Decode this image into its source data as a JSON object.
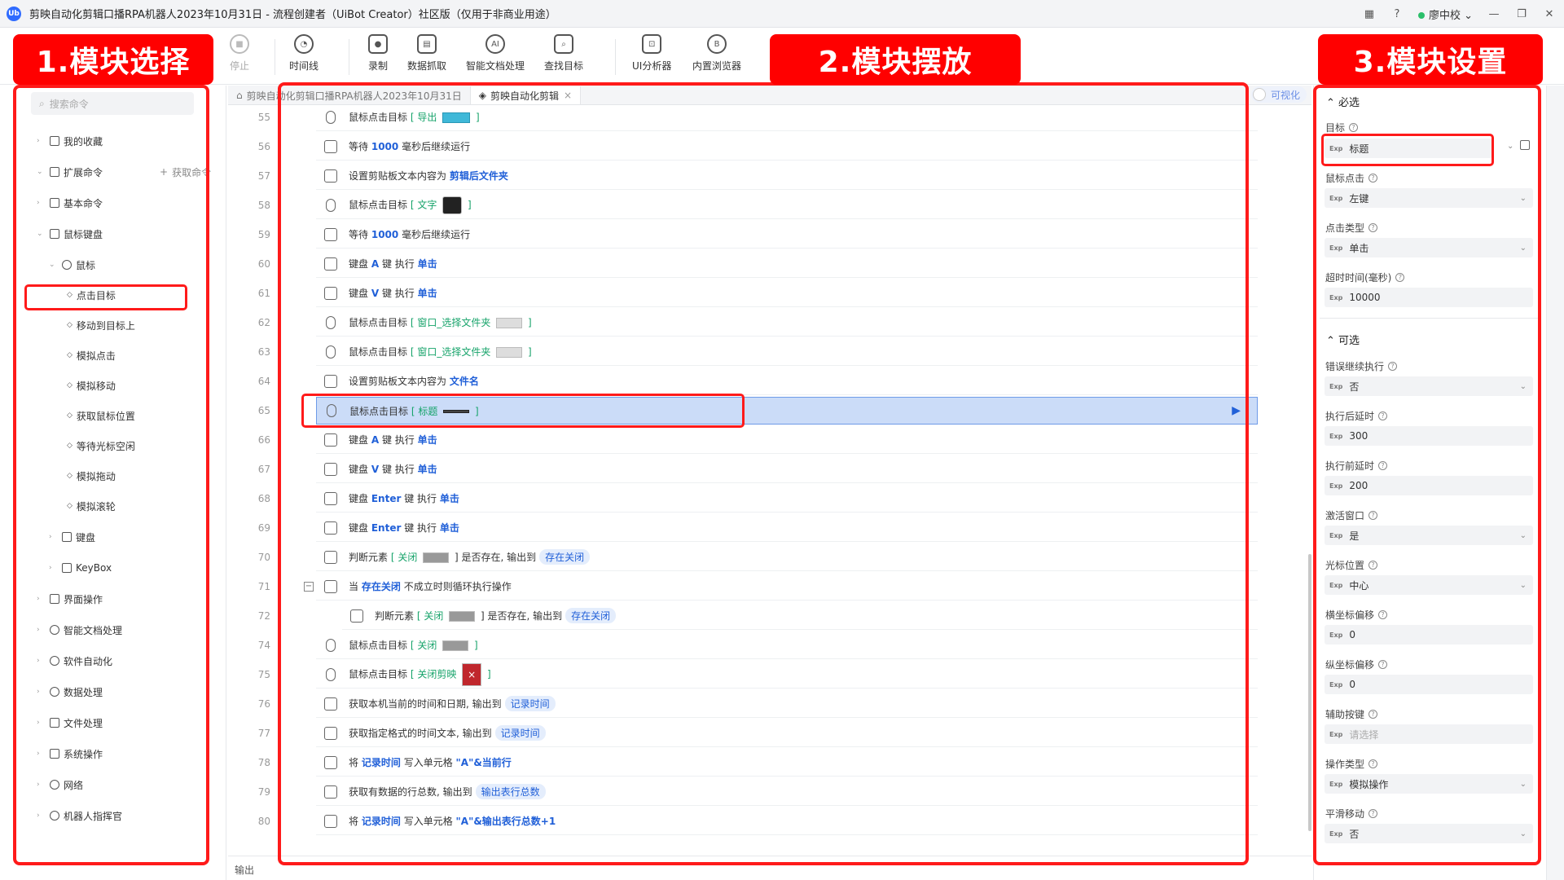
{
  "window": {
    "title": "剪映自动化剪辑口播RPA机器人2023年10月31日 - 流程创建者（UiBot Creator）社区版（仅用于非商业用途）",
    "user": "廖中校"
  },
  "toolbar": {
    "stop": "停止",
    "timeline": "时间线",
    "record": "录制",
    "data_capture": "数据抓取",
    "ai_doc": "智能文档处理",
    "find_target": "查找目标",
    "ui_analyzer": "UI分析器",
    "browser": "内置浏览器"
  },
  "callouts": {
    "c1": "1.模块选择",
    "c2": "2.模块摆放",
    "c3": "3.模块设置"
  },
  "left": {
    "search_placeholder": "搜索命令",
    "get_cmd": "获取命令",
    "items": {
      "favorites": "我的收藏",
      "ext": "扩展命令",
      "basic": "基本命令",
      "mouse_kb": "鼠标键盘",
      "mouse": "鼠标",
      "click_target": "点击目标",
      "move_to": "移动到目标上",
      "sim_click": "模拟点击",
      "sim_move": "模拟移动",
      "get_pos": "获取鼠标位置",
      "wait_cursor": "等待光标空闲",
      "sim_drag": "模拟拖动",
      "sim_wheel": "模拟滚轮",
      "keyboard": "键盘",
      "keybox": "KeyBox",
      "ui_ops": "界面操作",
      "ai_doc": "智能文档处理",
      "software": "软件自动化",
      "data": "数据处理",
      "file": "文件处理",
      "system": "系统操作",
      "network": "网络",
      "robot": "机器人指挥官"
    }
  },
  "editor": {
    "tab1": "剪映自动化剪辑口播RPA机器人2023年10月31日",
    "tab2": "剪映自动化剪辑",
    "visualize": "可视化",
    "footer": "输出"
  },
  "rows": [
    {
      "ln": "55",
      "a": "鼠标点击目标",
      "b": "[ 导出 ",
      "c": " ]"
    },
    {
      "ln": "56",
      "a": "等待",
      "b": "1000",
      "c": "毫秒后继续运行"
    },
    {
      "ln": "57",
      "a": "设置剪贴板文本内容为",
      "b": "剪辑后文件夹",
      "c": ""
    },
    {
      "ln": "58",
      "a": "鼠标点击目标",
      "b": "[ 文字 ",
      "c": " ]"
    },
    {
      "ln": "59",
      "a": "等待",
      "b": "1000",
      "c": "毫秒后继续运行"
    },
    {
      "ln": "60",
      "a": "键盘",
      "b": "A",
      "c": "键 执行",
      "d": "单击"
    },
    {
      "ln": "61",
      "a": "键盘",
      "b": "V",
      "c": "键 执行",
      "d": "单击"
    },
    {
      "ln": "62",
      "a": "鼠标点击目标",
      "b": "[ 窗口_选择文件夹 ",
      "c": " ]"
    },
    {
      "ln": "63",
      "a": "鼠标点击目标",
      "b": "[ 窗口_选择文件夹 ",
      "c": " ]"
    },
    {
      "ln": "64",
      "a": "设置剪贴板文本内容为",
      "b": "文件名",
      "c": ""
    },
    {
      "ln": "65",
      "a": "鼠标点击目标",
      "b": "[ 标题 ",
      "c": " ]"
    },
    {
      "ln": "66",
      "a": "键盘",
      "b": "A",
      "c": "键 执行",
      "d": "单击"
    },
    {
      "ln": "67",
      "a": "键盘",
      "b": "V",
      "c": "键 执行",
      "d": "单击"
    },
    {
      "ln": "68",
      "a": "键盘",
      "b": "Enter",
      "c": "键 执行",
      "d": "单击"
    },
    {
      "ln": "69",
      "a": "键盘",
      "b": "Enter",
      "c": "键 执行",
      "d": "单击"
    },
    {
      "ln": "70",
      "a": "判断元素",
      "b": "[ 关闭 ",
      "c": " ] 是否存在, 输出到",
      "d": "存在关闭"
    },
    {
      "ln": "71",
      "a": "当",
      "b": "存在关闭",
      "c": "不成立时则循环执行操作"
    },
    {
      "ln": "72",
      "a": "判断元素",
      "b": "[ 关闭 ",
      "c": " ] 是否存在, 输出到",
      "d": "存在关闭"
    },
    {
      "ln": "74",
      "a": "鼠标点击目标",
      "b": "[ 关闭 ",
      "c": " ]"
    },
    {
      "ln": "75",
      "a": "鼠标点击目标",
      "b": "[ 关闭剪映 ",
      "c": " ]"
    },
    {
      "ln": "76",
      "a": "获取本机当前的时间和日期, 输出到",
      "b": "记录时间",
      "c": ""
    },
    {
      "ln": "77",
      "a": "获取指定格式的时间文本, 输出到",
      "b": "记录时间",
      "c": ""
    },
    {
      "ln": "78",
      "a": "将",
      "b": "记录时间",
      "c": "写入单元格",
      "d": "\"A\"&当前行"
    },
    {
      "ln": "79",
      "a": "获取有数据的行总数, 输出到",
      "b": "输出表行总数",
      "c": ""
    },
    {
      "ln": "80",
      "a": "将",
      "b": "记录时间",
      "c": "写入单元格",
      "d": "\"A\"&输出表行总数+1"
    }
  ],
  "props": {
    "required": "必选",
    "optional": "可选",
    "exp": "Exp",
    "fields": {
      "target_label": "目标",
      "target_value": "标题",
      "mouse_label": "鼠标点击",
      "mouse_value": "左键",
      "clicktype_label": "点击类型",
      "clicktype_value": "单击",
      "timeout_label": "超时时间(毫秒)",
      "timeout_value": "10000",
      "continue_label": "错误继续执行",
      "continue_value": "否",
      "after_label": "执行后延时",
      "after_value": "300",
      "before_label": "执行前延时",
      "before_value": "200",
      "activate_label": "激活窗口",
      "activate_value": "是",
      "cursor_label": "光标位置",
      "cursor_value": "中心",
      "xoff_label": "横坐标偏移",
      "xoff_value": "0",
      "yoff_label": "纵坐标偏移",
      "yoff_value": "0",
      "aux_label": "辅助按键",
      "aux_placeholder": "请选择",
      "optype_label": "操作类型",
      "optype_value": "模拟操作",
      "smooth_label": "平滑移动",
      "smooth_value": "否"
    }
  },
  "colors": {
    "accent": "#2160d8",
    "callout": "#ff0000",
    "selected_row": "#cbdcf8"
  }
}
